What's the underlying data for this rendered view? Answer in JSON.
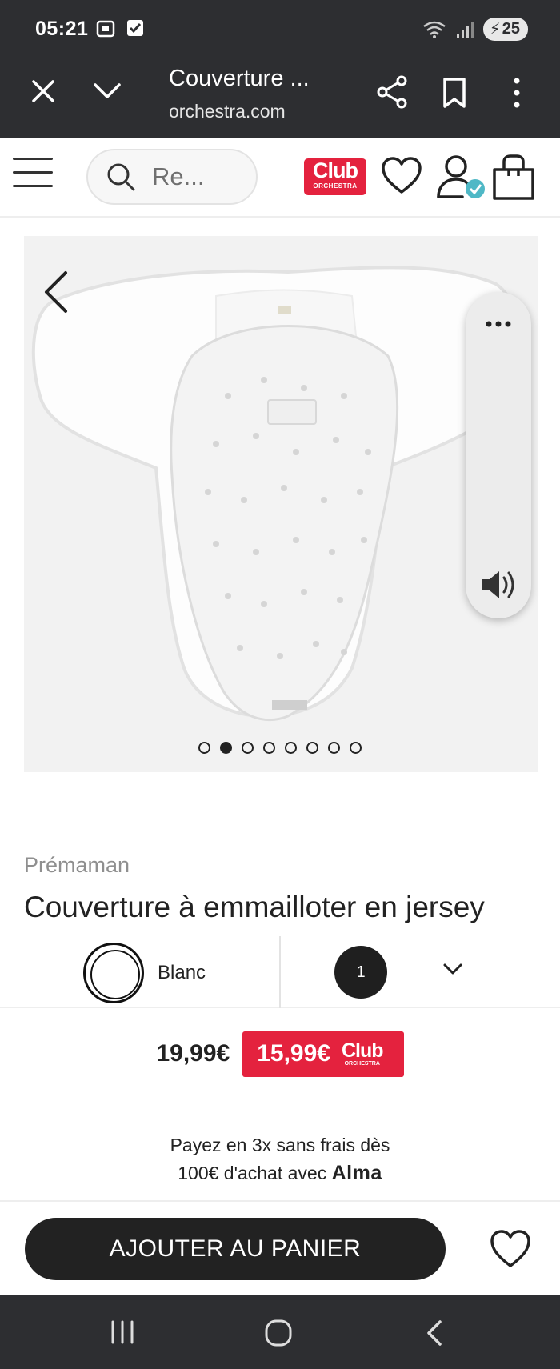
{
  "status_bar": {
    "time": "05:21",
    "battery": "25"
  },
  "browser": {
    "tab_title": "Couverture ...",
    "url": "orchestra.com"
  },
  "site_header": {
    "search_placeholder": "Re...",
    "club_logo_big": "Club",
    "club_logo_small": "ORCHESTRA"
  },
  "gallery": {
    "image_count": 8,
    "active_index": 1
  },
  "product": {
    "brand": "Prémaman",
    "title": "Couverture à emmailloter en jersey",
    "color_label": "Blanc",
    "quantity": "1"
  },
  "pricing": {
    "regular_price": "19,99€",
    "club_price": "15,99€",
    "club_logo_big": "Club",
    "club_logo_small": "ORCHESTRA"
  },
  "payment": {
    "line1": "Payez en 3x sans frais dès",
    "line2": "100€ d'achat avec",
    "provider": "Alma"
  },
  "cta": {
    "add_to_cart": "AJOUTER AU PANIER"
  },
  "colors": {
    "accent_red": "#e4223e",
    "dark": "#222222",
    "chrome": "#2d2e31"
  },
  "icons": [
    "close-icon",
    "chevron-down-icon",
    "share-icon",
    "bookmark-icon",
    "more-vert-icon",
    "menu-icon",
    "search-icon",
    "heart-icon",
    "user-icon",
    "bag-icon",
    "chevron-left-icon",
    "more-horiz-icon",
    "volume-icon",
    "recents-icon",
    "home-icon",
    "back-icon"
  ]
}
